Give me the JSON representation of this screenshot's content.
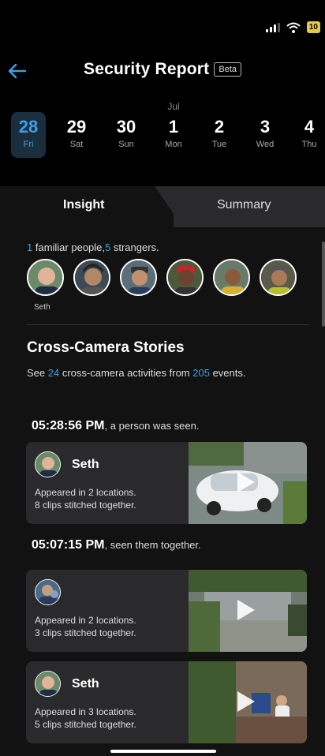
{
  "status_bar": {
    "battery": "10"
  },
  "header": {
    "title": "Security Report",
    "badge": "Beta"
  },
  "date_strip": {
    "month": "Jul",
    "days": [
      {
        "num": "28",
        "weekday": "Fri",
        "selected": true
      },
      {
        "num": "29",
        "weekday": "Sat"
      },
      {
        "num": "30",
        "weekday": "Sun"
      },
      {
        "num": "1",
        "weekday": "Mon"
      },
      {
        "num": "2",
        "weekday": "Tue"
      },
      {
        "num": "3",
        "weekday": "Wed"
      },
      {
        "num": "4",
        "weekday": "Thu"
      }
    ]
  },
  "tabs": {
    "insight": "Insight",
    "summary": "Summary"
  },
  "people": {
    "familiar_count": "1",
    "familiar_text": " familiar people,",
    "stranger_count": "5",
    "stranger_text": " strangers.",
    "first_label": "Seth"
  },
  "cross_camera": {
    "title": "Cross-Camera Stories",
    "sub_prefix": "See ",
    "activities": "24",
    "sub_mid": " cross-camera activities from ",
    "events": "205",
    "sub_suffix": " events."
  },
  "events": [
    {
      "time": "05:28:56 PM",
      "desc": ", a person was seen."
    },
    {
      "time": "05:07:15 PM",
      "desc": ", seen them together."
    }
  ],
  "cards": [
    {
      "name": "Seth",
      "line1": "Appeared in 2 locations.",
      "line2": "8 clips stitched together."
    },
    {
      "name": "",
      "line1": "Appeared in 2 locations.",
      "line2": "3 clips stitched together."
    },
    {
      "name": "Seth",
      "line1": "Appeared in 3 locations.",
      "line2": "5 clips stitched together."
    }
  ],
  "icons": {
    "back": "arrow-left-icon",
    "wifi": "wifi-icon",
    "signal": "signal-icon",
    "play": "play-icon"
  },
  "colors": {
    "accent": "#3aa0e8",
    "card": "#2a2a2c",
    "background": "#121212"
  }
}
